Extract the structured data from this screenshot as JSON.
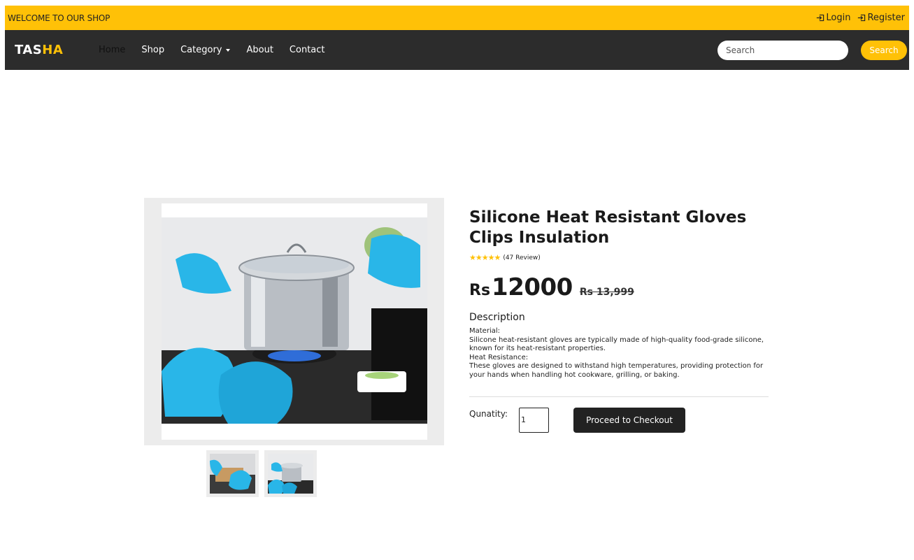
{
  "topbar": {
    "welcome": "WELCOME TO OUR SHOP",
    "login": "Login",
    "register": "Register"
  },
  "navbar": {
    "brand_part1": "TAS",
    "brand_part2": "HA",
    "links": [
      "Home",
      "Shop",
      "Category",
      "About",
      "Contact"
    ],
    "search_placeholder": "Search",
    "search_button": "Search"
  },
  "product": {
    "title": "Silicone Heat Resistant Gloves Clips Insulation",
    "stars": "★★★★★",
    "reviews": "(47 Review)",
    "currency": "Rs",
    "price": "12000",
    "old_price": "Rs 13,999",
    "description_heading": "Description",
    "description_lines": [
      "Material:",
      "Silicone heat-resistant gloves are typically made of high-quality food-grade silicone, known for its heat-resistant properties.",
      "Heat Resistance:",
      "These gloves are designed to withstand high temperatures, providing protection for your hands when handling hot cookware, grilling, or baking."
    ],
    "quantity_label": "Qunatity:",
    "quantity_value": "1",
    "checkout_button": "Proceed to Checkout"
  },
  "colors": {
    "accent": "#ffc107",
    "nav_bg": "#2c2c2c",
    "glove": "#29b6e8"
  }
}
